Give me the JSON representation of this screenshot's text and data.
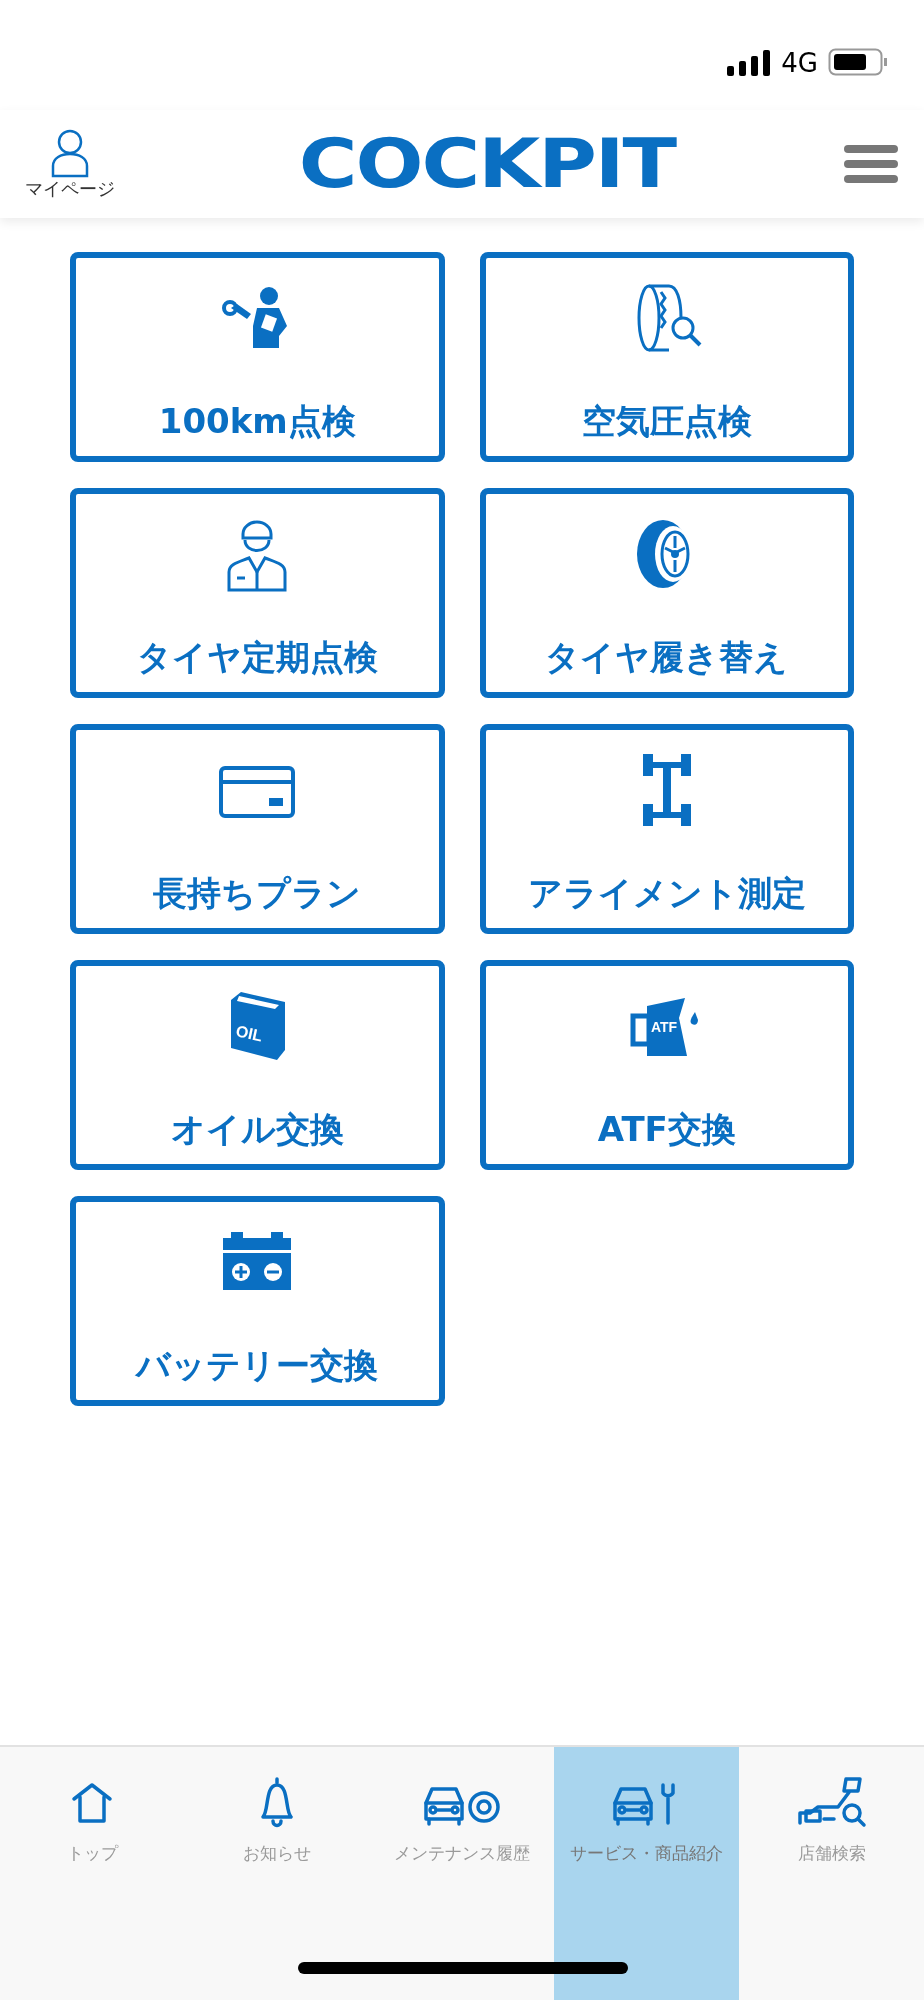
{
  "status_bar": {
    "network": "4G"
  },
  "header": {
    "mypage_label": "マイページ",
    "logo": "COCKPIT"
  },
  "services": [
    {
      "label": "100km点検",
      "kind": "mechanic"
    },
    {
      "label": "空気圧点検",
      "kind": "tire-search"
    },
    {
      "label": "タイヤ定期点検",
      "kind": "worker"
    },
    {
      "label": "タイヤ履き替え",
      "kind": "tire"
    },
    {
      "label": "長持ちプラン",
      "kind": "card"
    },
    {
      "label": "アライメント測定",
      "kind": "chassis"
    },
    {
      "label": "オイル交換",
      "kind": "oil",
      "icon_text": "OIL"
    },
    {
      "label": "ATF交換",
      "kind": "jug",
      "icon_text": "ATF"
    },
    {
      "label": "バッテリー交換",
      "kind": "battery"
    }
  ],
  "bottom_nav": [
    {
      "label": "トップ",
      "kind": "home",
      "selected": false
    },
    {
      "label": "お知らせ",
      "kind": "bell",
      "selected": false
    },
    {
      "label": "メンテナンス履歴",
      "kind": "car-wheel",
      "selected": false
    },
    {
      "label": "サービス・商品紹介",
      "kind": "car-wrench",
      "selected": true
    },
    {
      "label": "店舗検索",
      "kind": "map-search",
      "selected": false
    }
  ]
}
